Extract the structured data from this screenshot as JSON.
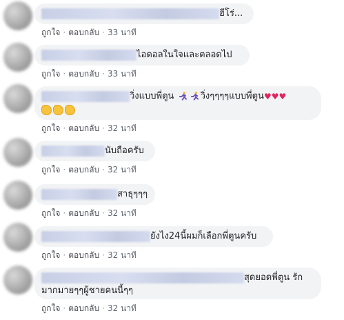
{
  "comments": [
    {
      "text": "ฮีโร่...",
      "action_like": "ถูกใจ",
      "action_reply": "ตอบกลับ",
      "time": "33 นาที"
    },
    {
      "text": "ไอดอลในใจและตลอดไป",
      "action_like": "ถูกใจ",
      "action_reply": "ตอบกลับ",
      "time": "33 นาที"
    },
    {
      "text_a": "วิ่งแบบพี่ตูน",
      "text_b": "วิ่งๆๆๆๆแบบพี่ตูน",
      "action_like": "ถูกใจ",
      "action_reply": "ตอบกลับ",
      "time": "32 นาที"
    },
    {
      "text": "นับถือครับ",
      "action_like": "ถูกใจ",
      "action_reply": "ตอบกลับ",
      "time": "32 นาที"
    },
    {
      "text": "สาธุๆๆๆ",
      "action_like": "ถูกใจ",
      "action_reply": "ตอบกลับ",
      "time": "32 นาที"
    },
    {
      "text": "ยังไง24นี้ผมก็เลือกพี่ตูนครับ",
      "action_like": "ถูกใจ",
      "action_reply": "ตอบกลับ",
      "time": "32 นาที"
    },
    {
      "text_line1": "สุดยอดพี่ตูน รัก",
      "text_line2": "มากมายๆๆผู้ชายคนนี้ๆๆ",
      "action_like": "ถูกใจ",
      "action_reply": "ตอบกลับ",
      "time": "32 นาที"
    }
  ],
  "icons": {
    "runner": "running-person-emoji",
    "heart": "heart-emoji",
    "clap": "clapping-hands-emoji"
  }
}
